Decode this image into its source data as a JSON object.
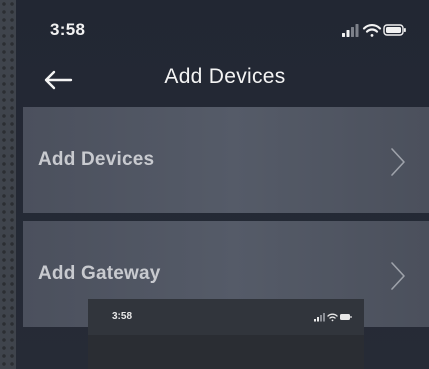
{
  "status_bar": {
    "time": "3:58",
    "icons": [
      "cellular-signal-icon",
      "wifi-icon",
      "battery-icon"
    ]
  },
  "nav": {
    "back_icon": "arrow-left-icon",
    "title": "Add Devices"
  },
  "menu": [
    {
      "label": "Add Devices",
      "icon": "chevron-right-icon"
    },
    {
      "label": "Add Gateway",
      "icon": "chevron-right-icon"
    }
  ],
  "overlay_preview": {
    "time": "3:58",
    "icons": [
      "cellular-signal-icon",
      "wifi-icon",
      "battery-icon"
    ]
  },
  "colors": {
    "screen_background": "#242935",
    "card_background": "#505562",
    "text_primary": "#f4f4f4",
    "text_card": "#c8cacf"
  }
}
